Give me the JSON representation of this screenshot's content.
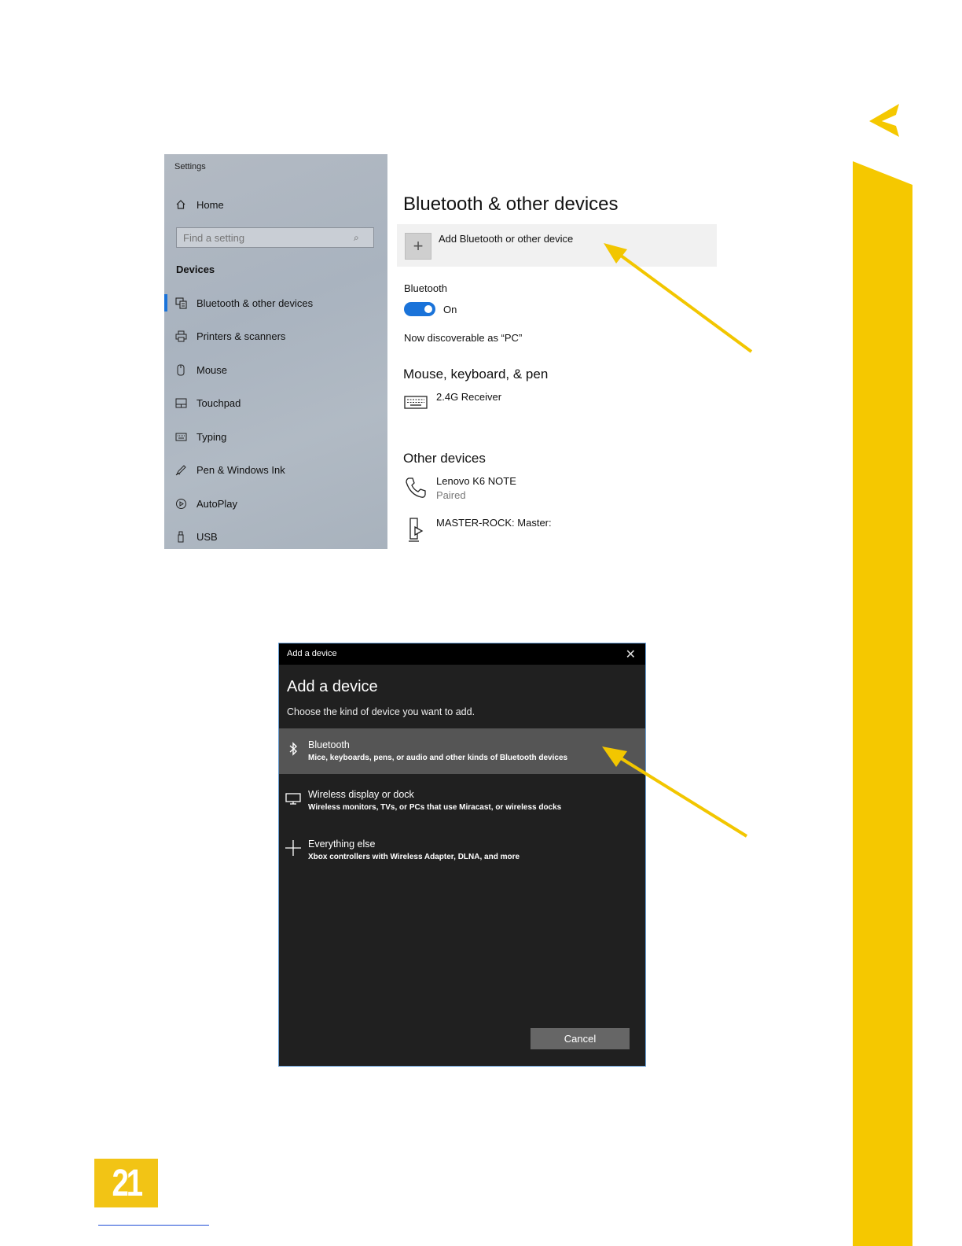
{
  "settings": {
    "window_title": "Settings",
    "home_label": "Home",
    "search_placeholder": "Find a setting",
    "section_title": "Devices",
    "nav_items": [
      {
        "label": "Bluetooth & other devices",
        "icon": "bluetooth-devices-icon"
      },
      {
        "label": "Printers & scanners",
        "icon": "printer-icon"
      },
      {
        "label": "Mouse",
        "icon": "mouse-icon"
      },
      {
        "label": "Touchpad",
        "icon": "touchpad-icon"
      },
      {
        "label": "Typing",
        "icon": "keyboard-icon"
      },
      {
        "label": "Pen & Windows Ink",
        "icon": "pen-icon"
      },
      {
        "label": "AutoPlay",
        "icon": "autoplay-icon"
      },
      {
        "label": "USB",
        "icon": "usb-icon"
      }
    ],
    "selected_nav": "Bluetooth & other devices",
    "accent_color": "#1a73d9",
    "content": {
      "title": "Bluetooth & other devices",
      "add_device_label": "Add Bluetooth or other device",
      "bluetooth_label": "Bluetooth",
      "bluetooth_state": "On",
      "discoverable_text": "Now discoverable as “PC”",
      "mouse_section": "Mouse, keyboard, & pen",
      "mouse_devices": [
        {
          "name": "2.4G Receiver",
          "icon": "keyboard-icon"
        }
      ],
      "other_section": "Other devices",
      "other_devices": [
        {
          "name": "Lenovo K6 NOTE",
          "status": "Paired",
          "icon": "phone-icon"
        },
        {
          "name": "MASTER-ROCK: Master:",
          "status": "",
          "icon": "media-device-icon"
        }
      ]
    }
  },
  "dialog": {
    "window_title": "Add a device",
    "heading": "Add a device",
    "subtitle": "Choose the kind of device you want to add.",
    "options": [
      {
        "title": "Bluetooth",
        "desc": "Mice, keyboards, pens, or audio and other kinds of Bluetooth devices",
        "icon": "bluetooth-icon",
        "highlighted": true
      },
      {
        "title": "Wireless display or dock",
        "desc": "Wireless monitors, TVs, or PCs that use Miracast, or wireless docks",
        "icon": "monitor-icon",
        "highlighted": false
      },
      {
        "title": "Everything else",
        "desc": "Xbox controllers with Wireless Adapter, DLNA, and more",
        "icon": "plus-icon",
        "highlighted": false
      }
    ],
    "cancel_label": "Cancel"
  },
  "page": {
    "number": "21",
    "accent_color": "#f5c800",
    "arrow_color": "#f2c600"
  }
}
